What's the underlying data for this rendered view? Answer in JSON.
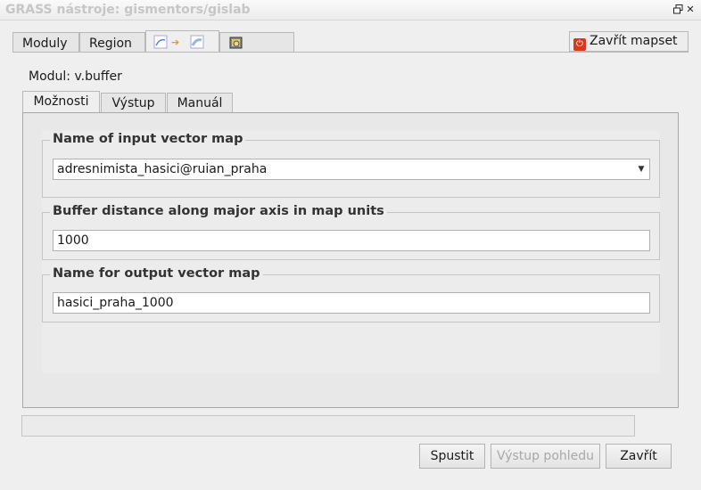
{
  "window": {
    "title": "GRASS nástroje: gismentors/gislab",
    "restore_icon": "restore-icon",
    "close_icon": "close-icon"
  },
  "top_tabs": [
    {
      "label": "Moduly"
    },
    {
      "label": "Region"
    },
    {
      "label": "",
      "icon": "vector-buffer-icon",
      "arrow": "➔"
    },
    {
      "label": "",
      "icon": "hand-map-icon"
    }
  ],
  "close_mapset": {
    "label": "Zavřít mapset",
    "icon": "power-icon"
  },
  "module": {
    "label": "Modul: v.buffer"
  },
  "sub_tabs": [
    {
      "label": "Možnosti"
    },
    {
      "label": "Výstup"
    },
    {
      "label": "Manuál"
    }
  ],
  "fields": {
    "input_map": {
      "label": "Name of input vector map",
      "value": "adresnimista_hasici@ruian_praha"
    },
    "distance": {
      "label": "Buffer distance along major axis in map units",
      "value": "1000"
    },
    "output_map": {
      "label": "Name for output vector map",
      "value": "hasici_praha_1000"
    }
  },
  "buttons": {
    "run": "Spustit",
    "view_output": "Výstup pohledu",
    "close": "Zavřít"
  }
}
